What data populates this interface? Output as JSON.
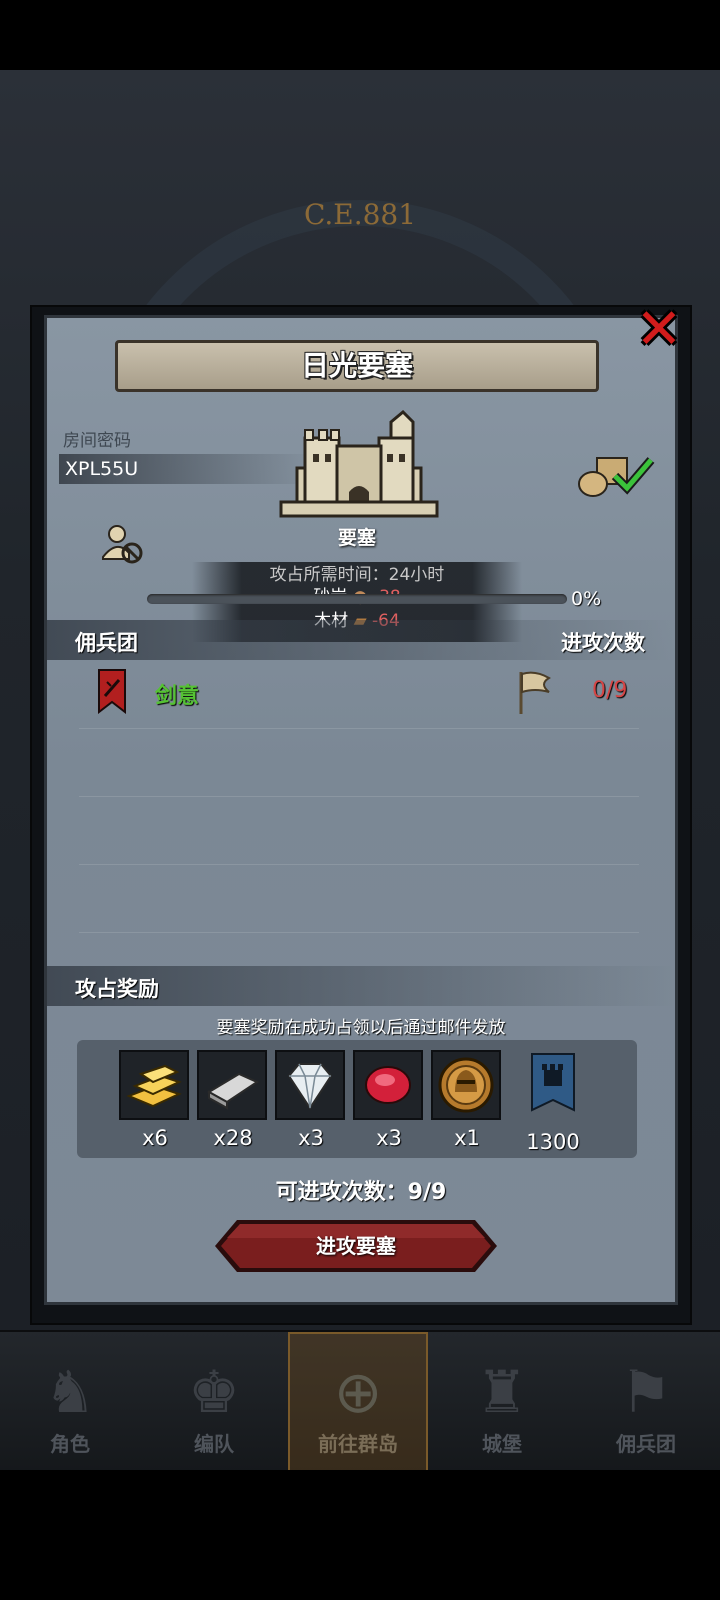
{
  "background": {
    "era_label": "C.E.881"
  },
  "nav": {
    "items": [
      {
        "label": "角色",
        "glyph": "♞"
      },
      {
        "label": "编队",
        "glyph": "♚"
      },
      {
        "label": "前往群岛",
        "glyph": "⊕"
      },
      {
        "label": "城堡",
        "glyph": "♜"
      },
      {
        "label": "佣兵团",
        "glyph": "⚑"
      }
    ],
    "active_index": 2
  },
  "modal": {
    "title": "日光要塞",
    "close_icon": "close-x-icon",
    "room_label": "房间密码",
    "room_code": "XPL55U",
    "fortress_name": "要塞",
    "occupy_time": "攻占所需时间：24小时",
    "cost_sandstone_label": "砂岩",
    "cost_sandstone_value": "-38",
    "cost_wood_label": "木材",
    "cost_wood_value": "-64",
    "progress_percent": "0%",
    "progress_value": 0,
    "merc_header": "佣兵团",
    "attack_header": "进攻次数",
    "merc_name": "剑意",
    "merc_attacks": "0/9",
    "reward_header": "攻占奖励",
    "reward_note": "要塞奖励在成功占领以后通过邮件发放",
    "rewards": [
      {
        "icon": "gold-bar-icon",
        "count": "x6"
      },
      {
        "icon": "silver-bar-icon",
        "count": "x28"
      },
      {
        "icon": "diamond-icon",
        "count": "x3"
      },
      {
        "icon": "ruby-icon",
        "count": "x3"
      },
      {
        "icon": "knight-coin-icon",
        "count": "x1"
      },
      {
        "icon": "fortress-banner-icon",
        "count": "1300"
      }
    ],
    "attacks_available": "可进攻次数：9/9",
    "attack_button": "进攻要塞"
  },
  "colors": {
    "merc_name": "#55c234",
    "attack_count": "#d54545",
    "close": "#d11c1c",
    "cost_negative": "#e06060",
    "button": "#7a1e1e"
  }
}
